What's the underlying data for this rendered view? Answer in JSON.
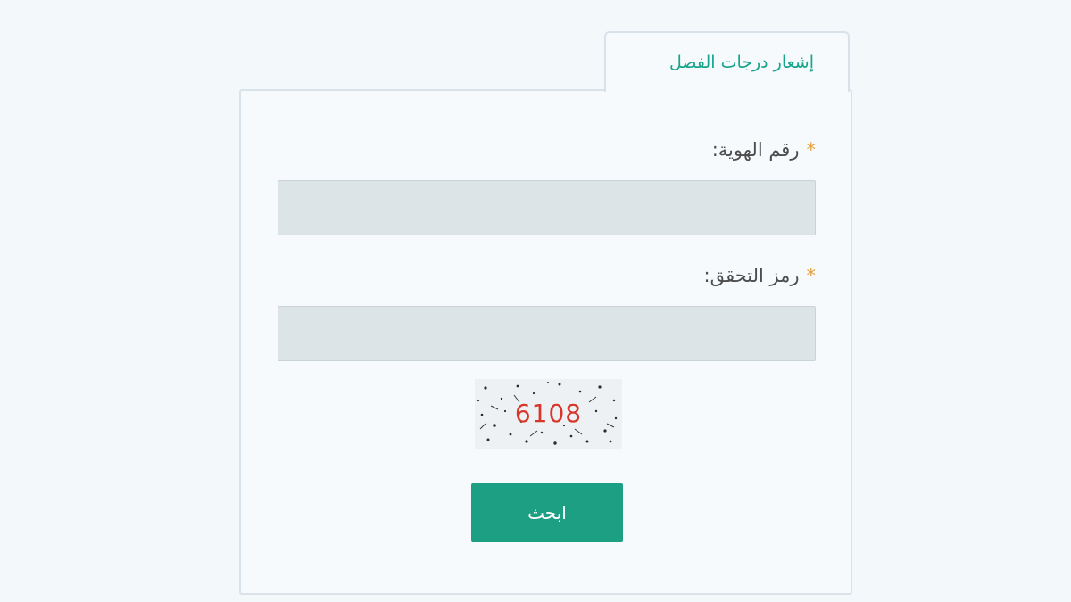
{
  "tab": {
    "label": "إشعار درجات الفصل"
  },
  "form": {
    "required_marker": "*",
    "id_field": {
      "label": "رقم الهوية:",
      "value": "",
      "placeholder": ""
    },
    "captcha_field": {
      "label": "رمز التحقق:",
      "value": "",
      "placeholder": ""
    },
    "captcha_image": {
      "text": "6108"
    },
    "submit_label": "ابحث"
  },
  "colors": {
    "background": "#f3f8fb",
    "tab_text": "#19a48c",
    "button": "#1d9f84",
    "required": "#e8a03a",
    "captcha_text": "#d9362a"
  }
}
